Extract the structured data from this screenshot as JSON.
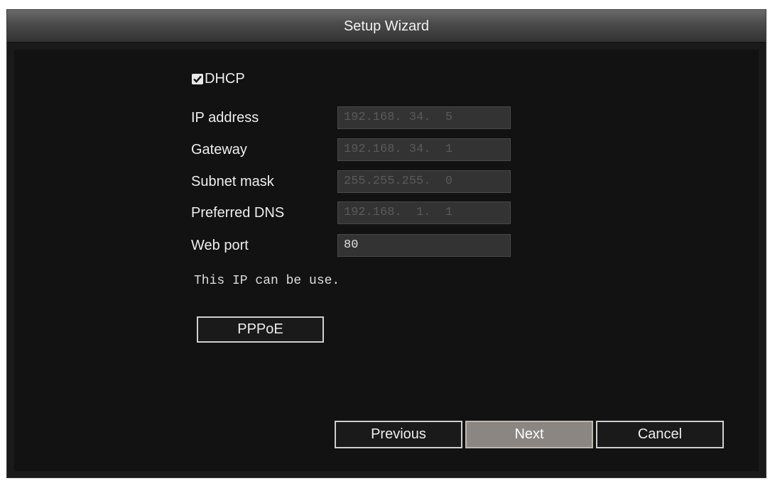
{
  "window": {
    "title": "Setup Wizard"
  },
  "dhcp": {
    "label": "DHCP",
    "checked": true
  },
  "fields": [
    {
      "label": "IP address",
      "value": "192.168. 34.  5"
    },
    {
      "label": "Gateway",
      "value": "192.168. 34.  1"
    },
    {
      "label": "Subnet mask",
      "value": "255.255.255.  0"
    },
    {
      "label": "Preferred DNS",
      "value": "192.168.  1.  1"
    },
    {
      "label": "Web port",
      "value": "80"
    }
  ],
  "status_message": "This IP can be use.",
  "buttons": {
    "pppoe": "PPPoE",
    "previous": "Previous",
    "next": "Next",
    "cancel": "Cancel"
  },
  "colors": {
    "window_bg": "#1a1a1a",
    "focused_button": "#8c8682",
    "disabled_text": "#5a5a5a"
  },
  "icons": {
    "dhcp_checkbox": "checkbox-checked-icon"
  }
}
